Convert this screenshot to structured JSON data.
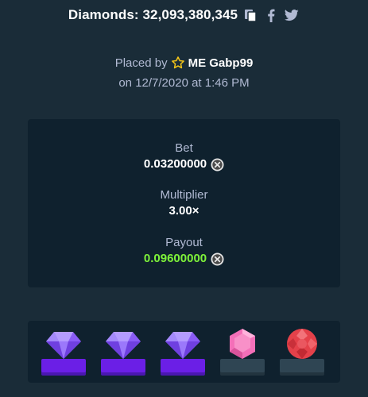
{
  "header": {
    "title": "Diamonds: 32,093,380,345",
    "share_icons": [
      "copy-icon",
      "facebook-icon",
      "twitter-icon"
    ]
  },
  "bet_info": {
    "placed_by_label": "Placed by",
    "username": "ME Gabp99",
    "date_text": "on 12/7/2020 at 1:46 PM"
  },
  "stats": {
    "bet_label": "Bet",
    "bet_value": "0.03200000",
    "multiplier_label": "Multiplier",
    "multiplier_value": "3.00×",
    "payout_label": "Payout",
    "payout_value": "0.09600000",
    "currency_icon": "coin-x-icon"
  },
  "gems": [
    {
      "type": "diamond",
      "color": "#8a5cf6",
      "matched": true
    },
    {
      "type": "diamond",
      "color": "#8a5cf6",
      "matched": true
    },
    {
      "type": "diamond",
      "color": "#8a5cf6",
      "matched": true
    },
    {
      "type": "pink-gem",
      "color": "#f46fb8",
      "matched": false
    },
    {
      "type": "red-gem",
      "color": "#e4414a",
      "matched": false
    }
  ],
  "colors": {
    "background": "#1a2c38",
    "panel": "#0f212e",
    "muted_text": "#b1bad3",
    "payout_green": "#7ef23a",
    "star": "#f5c518",
    "match_base": "#6b1fe6",
    "plain_base": "#2f4553"
  }
}
